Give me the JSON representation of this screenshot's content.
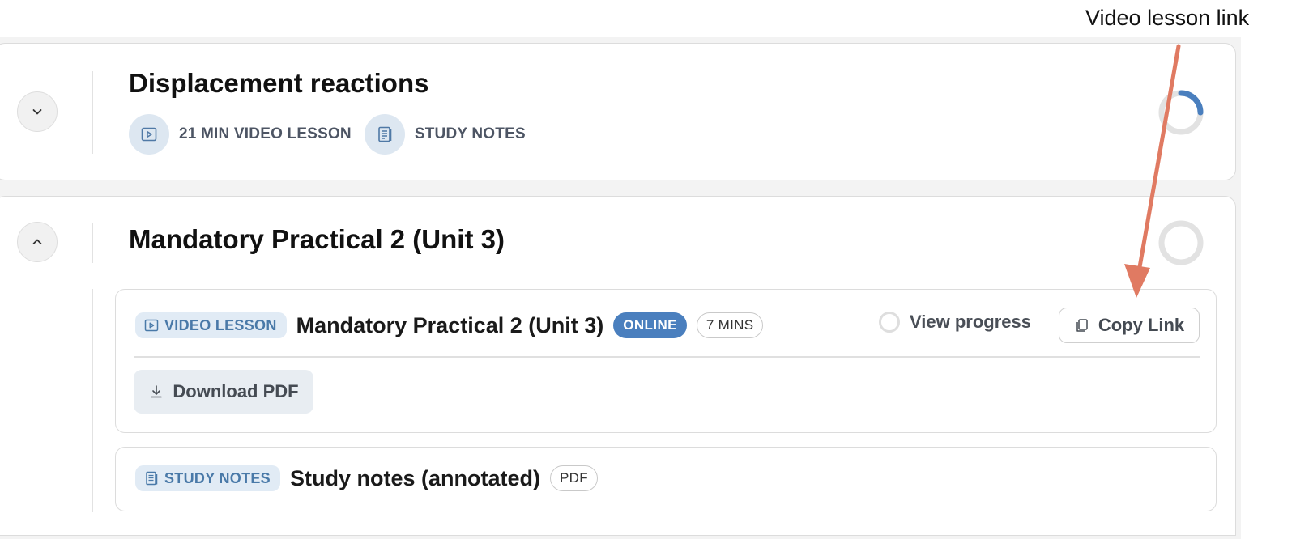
{
  "annotation": {
    "label": "Video lesson link",
    "color": "#e07a62"
  },
  "sections": [
    {
      "title": "Displacement reactions",
      "expanded": false,
      "progress": 0.25,
      "meta": [
        {
          "icon": "play-icon",
          "label": "21 MIN VIDEO LESSON"
        },
        {
          "icon": "notes-icon",
          "label": "STUDY NOTES"
        }
      ]
    },
    {
      "title": "Mandatory Practical 2 (Unit 3)",
      "expanded": true,
      "progress": 0,
      "items": [
        {
          "type_label": "VIDEO LESSON",
          "title": "Mandatory Practical 2 (Unit 3)",
          "status": "ONLINE",
          "duration": "7 MINS",
          "view_progress_label": "View progress",
          "copy_link_label": "Copy Link",
          "download_label": "Download PDF"
        },
        {
          "type_label": "STUDY NOTES",
          "title": "Study notes (annotated)",
          "format": "PDF"
        }
      ]
    }
  ],
  "colors": {
    "accent": "#4a7fbe",
    "tag_bg": "#e1ebf5",
    "tag_text": "#4979a8",
    "ring_track": "#e2e2e2"
  }
}
